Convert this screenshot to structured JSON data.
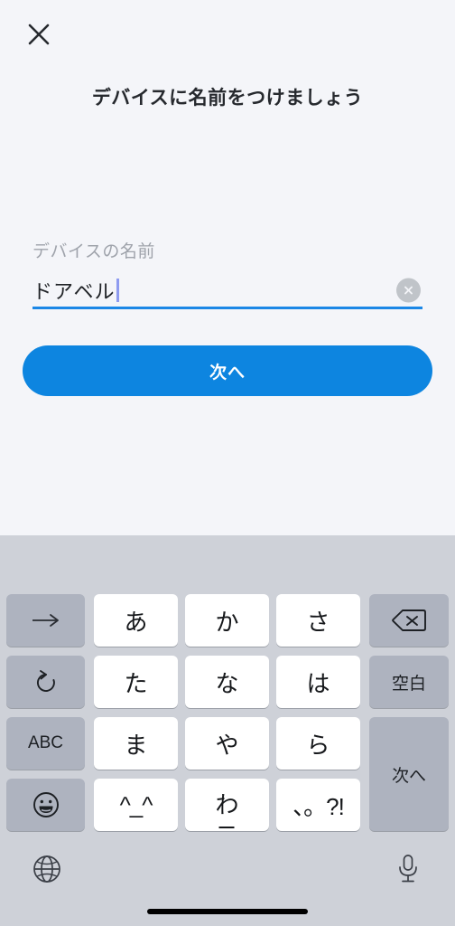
{
  "screen": {
    "background_color": "#f4f5f9",
    "accent_color": "#0d85e0"
  },
  "header": {
    "close_label": "close-icon",
    "title": "デバイスに名前をつけましょう"
  },
  "form": {
    "field_label": "デバイスの名前",
    "field_value": "ドアベル",
    "field_placeholder": "デバイスの名前",
    "clear_label": "clear-icon",
    "underline_color": "#1b87e6",
    "caret_color": "#8e9bf0"
  },
  "actions": {
    "primary_label": "次へ"
  },
  "keyboard": {
    "background_color": "#ced1d8",
    "char_key_color": "#ffffff",
    "function_key_color": "#aeb3bf",
    "rows": [
      {
        "keys": [
          {
            "name": "cursor-right-key",
            "label": "→",
            "type": "function",
            "icon": "arrow-right-icon"
          },
          {
            "name": "key-a",
            "label": "あ",
            "type": "char"
          },
          {
            "name": "key-ka",
            "label": "か",
            "type": "char"
          },
          {
            "name": "key-sa",
            "label": "さ",
            "type": "char"
          },
          {
            "name": "backspace-key",
            "label": "",
            "type": "function",
            "icon": "backspace-icon"
          }
        ]
      },
      {
        "keys": [
          {
            "name": "undo-key",
            "label": "↺",
            "type": "function",
            "icon": "undo-icon"
          },
          {
            "name": "key-ta",
            "label": "た",
            "type": "char"
          },
          {
            "name": "key-na",
            "label": "な",
            "type": "char"
          },
          {
            "name": "key-ha",
            "label": "は",
            "type": "char"
          },
          {
            "name": "space-key",
            "label": "空白",
            "type": "function"
          }
        ]
      },
      {
        "keys": [
          {
            "name": "abc-key",
            "label": "ABC",
            "type": "function"
          },
          {
            "name": "key-ma",
            "label": "ま",
            "type": "char"
          },
          {
            "name": "key-ya",
            "label": "や",
            "type": "char"
          },
          {
            "name": "key-ra",
            "label": "ら",
            "type": "char"
          },
          {
            "name": "return-key",
            "label": "次へ",
            "type": "function"
          }
        ]
      },
      {
        "keys": [
          {
            "name": "emoji-key",
            "label": "",
            "type": "function",
            "icon": "smiley-icon"
          },
          {
            "name": "kaomoji-key",
            "label": "^_^",
            "type": "char"
          },
          {
            "name": "key-wa",
            "label": "わ",
            "type": "char",
            "sub": "_"
          },
          {
            "name": "punctuation-key",
            "label": "、。?!",
            "type": "char"
          }
        ]
      }
    ],
    "bottom_bar": {
      "globe_label": "globe-icon",
      "mic_label": "microphone-icon"
    }
  }
}
